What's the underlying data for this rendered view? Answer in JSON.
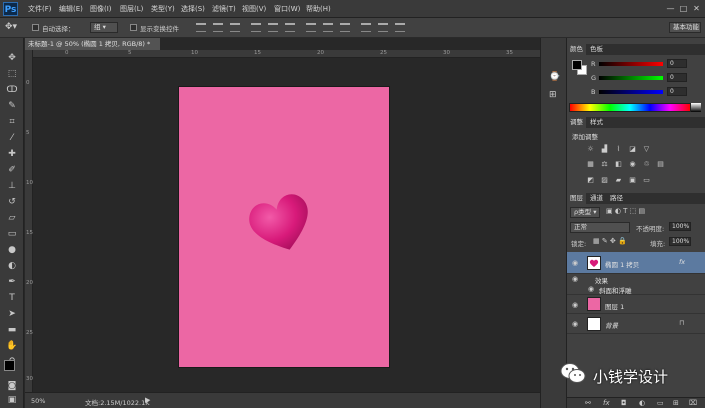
{
  "app": {
    "logo": "Ps"
  },
  "menu": [
    "文件(F)",
    "编辑(E)",
    "图像(I)",
    "图层(L)",
    "类型(Y)",
    "选择(S)",
    "滤镜(T)",
    "视图(V)",
    "窗口(W)",
    "帮助(H)"
  ],
  "window_controls": [
    "—",
    "□",
    "✕"
  ],
  "options": {
    "auto_select_label": "自动选择：",
    "auto_select_value": "组",
    "show_transform_label": "显示变换控件",
    "workspace": "基本功能"
  },
  "document": {
    "tab_title": "未标题-1 @ 50% (椭圆 1 拷贝, RGB/8) *",
    "tab_close": "×",
    "zoom": "50%",
    "doc_info": "文档:2.15M/1022.1K",
    "canvas_color": "#ec67a4",
    "heart_color": "#d81a7a"
  },
  "ruler_h": [
    "0",
    "5",
    "10",
    "15",
    "20",
    "25",
    "30",
    "35"
  ],
  "ruler_v": [
    "0",
    "5",
    "10",
    "15",
    "20",
    "25",
    "30"
  ],
  "color_panel": {
    "tabs": [
      "颜色",
      "色板"
    ],
    "channels": [
      {
        "label": "R",
        "value": "0"
      },
      {
        "label": "G",
        "value": "0"
      },
      {
        "label": "B",
        "value": "0"
      }
    ]
  },
  "adjustments_panel": {
    "tabs": [
      "调整",
      "样式"
    ],
    "title": "添加调整"
  },
  "layers_panel": {
    "tabs": [
      "图层",
      "通道",
      "路径"
    ],
    "kind_filter": "ρ类型",
    "blend_mode": "正常",
    "opacity_label": "不透明度:",
    "opacity_value": "100%",
    "lock_label": "锁定:",
    "fill_label": "填充:",
    "fill_value": "100%",
    "layers": [
      {
        "name": "椭圆 1 拷贝",
        "fx": "fx",
        "selected": true
      },
      {
        "name": "效果",
        "sub": true
      },
      {
        "name": "斜面和浮雕",
        "sub": true
      },
      {
        "name": "图层 1"
      },
      {
        "name": "背景",
        "locked": true
      }
    ]
  },
  "watermark": {
    "text": "小钱学设计"
  }
}
